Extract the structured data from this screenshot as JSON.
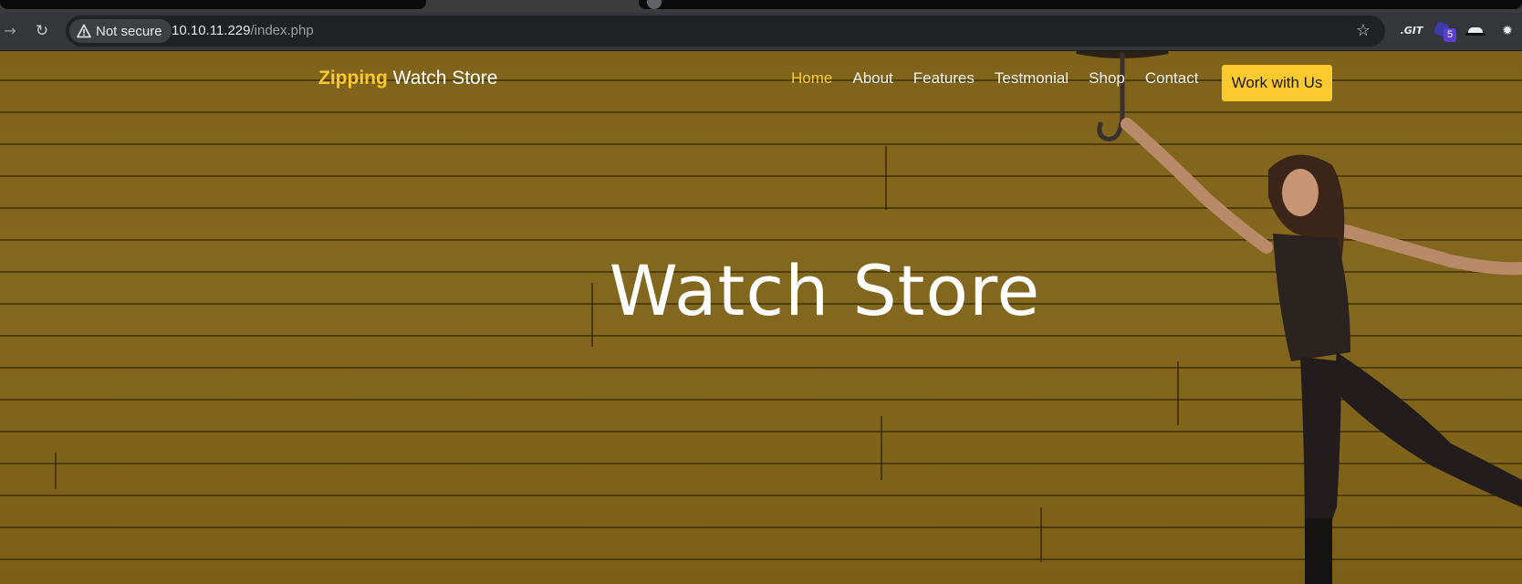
{
  "browser": {
    "security_label": "Not secure",
    "url_host": "10.10.11.229",
    "url_path": "/index.php",
    "extension_badge": "5",
    "extension_text": ".GIT",
    "icons": [
      "forward-icon",
      "reload-icon",
      "warning-icon",
      "star-icon",
      "git-extension-icon",
      "wappalyzer-extension-icon",
      "hat-extension-icon",
      "extensions-icon"
    ]
  },
  "site": {
    "brand_accent": "Zipping",
    "brand_rest": " Watch Store",
    "nav": [
      {
        "label": "Home",
        "active": true
      },
      {
        "label": "About",
        "active": false
      },
      {
        "label": "Features",
        "active": false
      },
      {
        "label": "Testmonial",
        "active": false
      },
      {
        "label": "Shop",
        "active": false
      },
      {
        "label": "Contact",
        "active": false
      }
    ],
    "cta_label": "Work with Us",
    "hero_title": "Watch Store"
  },
  "colors": {
    "accent": "#fcc92e",
    "wall": "#8a6d1e",
    "chrome_bg": "#35363a",
    "omnibox_bg": "#202124"
  }
}
